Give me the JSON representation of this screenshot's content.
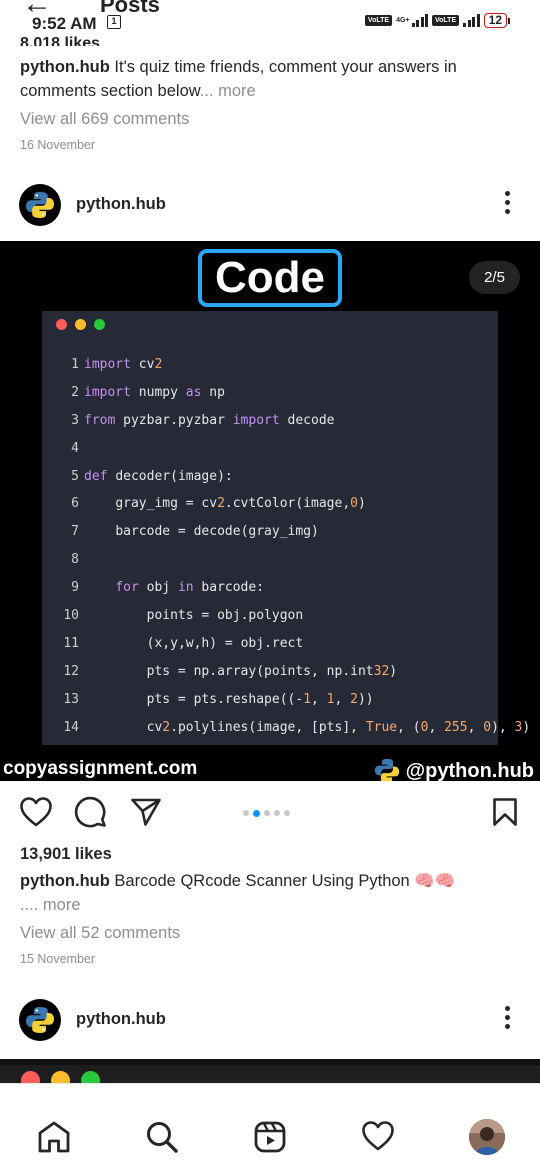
{
  "status_bar": {
    "time": "9:52 AM",
    "notification_badge": "1",
    "network_type": "4G+",
    "volte_label": "Vo LTE",
    "battery_level": "12"
  },
  "header": {
    "title": "Posts",
    "back_icon": "arrow-left-icon"
  },
  "prev_post": {
    "likes_partial": "8,018 likes",
    "username": "python.hub",
    "caption": "It's quiz time friends, comment your answers in comments section below",
    "more_label": "... more",
    "comments_link": "View all 669 comments",
    "date": "16 November"
  },
  "post": {
    "username": "python.hub",
    "image": {
      "badge_text": "Code",
      "counter": "2/5",
      "code_lines": [
        {
          "n": "1",
          "text": "import cv2"
        },
        {
          "n": "2",
          "text": "import numpy as np"
        },
        {
          "n": "3",
          "text": "from pyzbar.pyzbar import decode"
        },
        {
          "n": "4",
          "text": ""
        },
        {
          "n": "5",
          "text": "def decoder(image):"
        },
        {
          "n": "6",
          "text": "    gray_img = cv2.cvtColor(image,0)"
        },
        {
          "n": "7",
          "text": "    barcode = decode(gray_img)"
        },
        {
          "n": "8",
          "text": ""
        },
        {
          "n": "9",
          "text": "    for obj in barcode:"
        },
        {
          "n": "10",
          "text": "        points = obj.polygon"
        },
        {
          "n": "11",
          "text": "        (x,y,w,h) = obj.rect"
        },
        {
          "n": "12",
          "text": "        pts = np.array(points, np.int32)"
        },
        {
          "n": "13",
          "text": "        pts = pts.reshape((-1, 1, 2))"
        },
        {
          "n": "14",
          "text": "        cv2.polylines(image, [pts], True, (0, 255, 0), 3)"
        }
      ],
      "watermark_left": "copyassignment.com",
      "watermark_right": "@python.hub"
    },
    "carousel": {
      "count": 5,
      "active_index": 1
    },
    "likes": "13,901 likes",
    "caption_username": "python.hub",
    "caption": "Barcode QRcode Scanner Using Python 🧠🧠",
    "more_label": ".... more",
    "comments_link": "View all 52 comments",
    "date": "15 November"
  },
  "next_post": {
    "username": "python.hub"
  },
  "bottom_nav": {
    "items": [
      "home-icon",
      "search-icon",
      "reels-icon",
      "heart-icon",
      "profile-avatar"
    ]
  },
  "colors": {
    "accent": "#0095f6",
    "badge_border": "#2aa7f5",
    "battery_border": "#dd1111",
    "code_bg": "#262a37",
    "mac_red": "#ff5f56",
    "mac_yellow": "#ffbd2e",
    "mac_green": "#27c93f"
  }
}
